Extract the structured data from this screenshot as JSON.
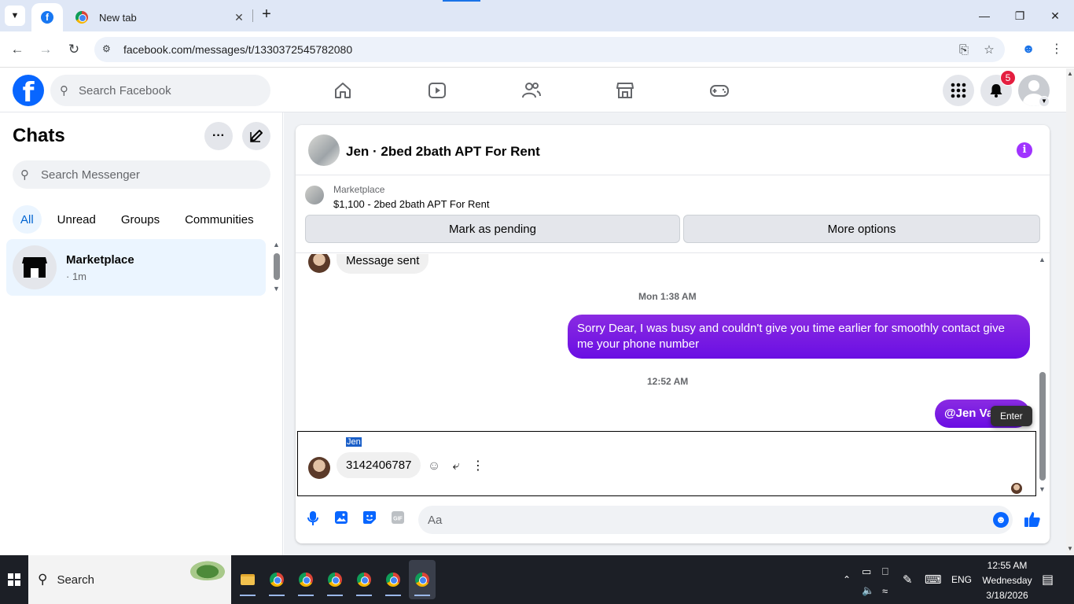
{
  "browser": {
    "tabs": [
      {
        "title": "",
        "favicon": "facebook-icon",
        "active": true
      },
      {
        "title": "New tab",
        "favicon": "chrome-icon",
        "active": false
      }
    ],
    "url": "facebook.com/messages/t/1330372545782080"
  },
  "facebook": {
    "search_placeholder": "Search Facebook",
    "notification_count": "5",
    "nav_icons": [
      "home-icon",
      "video-icon",
      "friends-icon",
      "marketplace-icon",
      "gaming-icon"
    ]
  },
  "chats_panel": {
    "title": "Chats",
    "search_placeholder": "Search Messenger",
    "filters": [
      "All",
      "Unread",
      "Groups",
      "Communities"
    ],
    "active_filter": "All",
    "items": [
      {
        "name": "Marketplace",
        "time": "· 1m"
      }
    ]
  },
  "conversation": {
    "title": "Jen · 2bed 2bath APT For Rent",
    "marketplace_label": "Marketplace",
    "listing": "$1,100 - 2bed 2bath APT For Rent",
    "mark_pending_label": "Mark as pending",
    "more_options_label": "More options",
    "messages": {
      "partial_in": "Message sent",
      "timestamp1": "Mon 1:38 AM",
      "out1": "Sorry Dear, I was busy and couldn't give you time earlier for smoothly contact give me your phone number",
      "timestamp2": "12:52 AM",
      "out2": "@Jen Vaz",
      "tooltip": "Enter",
      "sender_name": "Jen",
      "in_phone": "3142406787"
    },
    "composer_placeholder": "Aa"
  },
  "taskbar": {
    "search_label": "Search",
    "language": "ENG",
    "time": "12:55 AM",
    "day": "Wednesday",
    "date": "3/18/2026"
  },
  "colors": {
    "facebook_blue": "#0866ff",
    "outgoing_bubble": "#7011e8",
    "badge_red": "#e41e3f",
    "info_purple": "#a033ff"
  }
}
